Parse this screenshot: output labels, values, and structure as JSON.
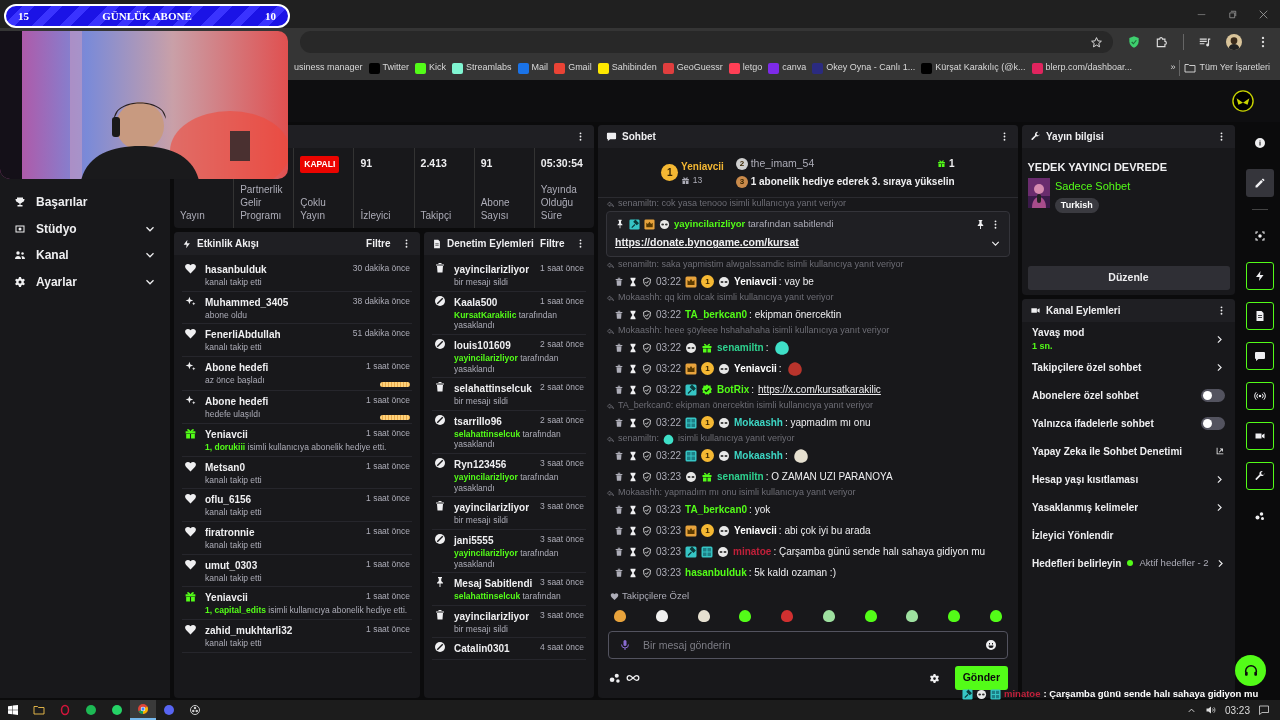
{
  "subscription_goal": {
    "current": "15",
    "title": "GÜNLÜK ABONE",
    "target": "10"
  },
  "browser": {
    "bookmarks": [
      {
        "label": "usiness manager"
      },
      {
        "label": "Twitter",
        "color": "#000000"
      },
      {
        "label": "Kick",
        "color": "#53fc18"
      },
      {
        "label": "Streamlabs",
        "color": "#80f5d2"
      },
      {
        "label": "Mail",
        "color": "#1a73e8"
      },
      {
        "label": "Gmail",
        "color": "#ea4335"
      },
      {
        "label": "Sahibinden",
        "color": "#ffe800"
      },
      {
        "label": "GeoGuessr",
        "color": "#e03e3e"
      },
      {
        "label": "letgo",
        "color": "#ff3f55"
      },
      {
        "label": "canva",
        "color": "#7d2ae8"
      },
      {
        "label": "Okey Oyna - Canlı 1...",
        "color": "#2b2b80"
      },
      {
        "label": "Kürşat Karakılıç (@k...",
        "color": "#000000"
      },
      {
        "label": "blerp.com/dashboar...",
        "color": "#e0245e"
      }
    ],
    "overflow": "»",
    "all_bookmarks": "Tüm Yer İşaretleri"
  },
  "sidebar": [
    {
      "kind": "trophy",
      "label": "Başarılar",
      "expandable": false
    },
    {
      "kind": "studio",
      "label": "Stüdyo",
      "expandable": true
    },
    {
      "kind": "people",
      "label": "Kanal",
      "expandable": true
    },
    {
      "kind": "gear",
      "label": "Ayarlar",
      "expandable": true
    }
  ],
  "stats": [
    {
      "label": "Yayın"
    },
    {
      "label": "Partnerlik Gelir Programı"
    },
    {
      "badge": "KAPALI",
      "label": "Çoklu Yayın"
    },
    {
      "value": "91",
      "label": "İzleyici"
    },
    {
      "value": "2.413",
      "label": "Takipçi"
    },
    {
      "value": "91",
      "label": "Abone Sayısı"
    },
    {
      "value": "05:30:54",
      "label": "Yayında Olduğu Süre"
    }
  ],
  "activity": {
    "title": "Etkinlik Akışı",
    "filter": "Filtre",
    "items": [
      {
        "kind": "heart",
        "name": "hasanbulduk",
        "time": "30 dakika önce",
        "text": "kanalı takip etti"
      },
      {
        "kind": "sparkle",
        "name": "Muhammed_3405",
        "time": "38 dakika önce",
        "text": "abone oldu"
      },
      {
        "kind": "heart",
        "name": "FenerliAbdullah",
        "time": "51 dakika önce",
        "text": "kanalı takip etti"
      },
      {
        "kind": "sparkle",
        "name": "Abone hedefi",
        "time": "1 saat önce",
        "text": "az önce başladı",
        "level": 1
      },
      {
        "kind": "sparkle",
        "name": "Abone hedefi",
        "time": "1 saat önce",
        "text": "hedefe ulaşıldı",
        "level": 1
      },
      {
        "kind": "gift",
        "name": "Yeniavcii",
        "time": "1 saat önce",
        "highlight": "1, dorukiii",
        "text": " isimli kullanıcıya abonelik hediye etti."
      },
      {
        "kind": "heart",
        "name": "Metsan0",
        "time": "1 saat önce",
        "text": "kanalı takip etti"
      },
      {
        "kind": "heart",
        "name": "oflu_6156",
        "time": "1 saat önce",
        "text": "kanalı takip etti"
      },
      {
        "kind": "heart",
        "name": "firatronnie",
        "time": "1 saat önce",
        "text": "kanalı takip etti"
      },
      {
        "kind": "heart",
        "name": "umut_0303",
        "time": "1 saat önce",
        "text": "kanalı takip etti"
      },
      {
        "kind": "gift",
        "name": "Yeniavcii",
        "time": "1 saat önce",
        "highlight": "1, capital_edits",
        "text": " isimli kullanıcıya abonelik hediye etti."
      },
      {
        "kind": "heart",
        "name": "zahid_mukhtarli32",
        "time": "1 saat önce",
        "text": "kanalı takip etti"
      }
    ]
  },
  "moderation": {
    "title": "Denetim Eylemleri",
    "filter": "Filtre",
    "items": [
      {
        "kind": "trash",
        "name": "yayincilarizliyor",
        "time": "1 saat önce",
        "text": "bir mesajı sildi"
      },
      {
        "kind": "ban",
        "name": "Kaala500",
        "time": "1 saat önce",
        "actor": "KursatKarakilic",
        "text": " tarafından yasaklandı"
      },
      {
        "kind": "ban",
        "name": "louis101609",
        "time": "2 saat önce",
        "actor": "yayincilarizliyor",
        "text": " tarafından yasaklandı"
      },
      {
        "kind": "trash",
        "name": "selahattinselcuk",
        "time": "2 saat önce",
        "text": "bir mesajı sildi"
      },
      {
        "kind": "ban",
        "name": "tsarrillo96",
        "time": "2 saat önce",
        "actor": "selahattinselcuk",
        "text": " tarafından yasaklandı"
      },
      {
        "kind": "ban",
        "name": "Ryn123456",
        "time": "3 saat önce",
        "actor": "yayincilarizliyor",
        "text": " tarafından yasaklandı"
      },
      {
        "kind": "trash",
        "name": "yayincilarizliyor",
        "time": "3 saat önce",
        "text": "bir mesajı sildi"
      },
      {
        "kind": "ban",
        "name": "jani5555",
        "time": "3 saat önce",
        "actor": "yayincilarizliyor",
        "text": " tarafından yasaklandı"
      },
      {
        "kind": "pin",
        "name": "Mesaj Sabitlendi",
        "time": "3 saat önce",
        "actor": "selahattinselcuk",
        "text": " tarafından"
      },
      {
        "kind": "trash",
        "name": "yayincilarizliyor",
        "time": "3 saat önce",
        "text": "bir mesajı sildi"
      },
      {
        "kind": "ban",
        "name": "Catalin0301",
        "time": "4 saat önce"
      }
    ]
  },
  "chat": {
    "title": "Sohbet",
    "leaderboard": {
      "first": {
        "rank": "1",
        "name": "Yeniavcii",
        "count": "13"
      },
      "second": {
        "rank": "2",
        "name": "the_imam_54",
        "count": "1"
      },
      "third": {
        "rank": "3",
        "text": "1 abonelik hediye ederek 3. sıraya yükselin"
      }
    },
    "top_reply": "senamiltn: cok yasa tenooo isimli kullanıcıya yanıt veriyor",
    "pinned": {
      "by": "yayincilarizliyor",
      "text": "tarafından sabitlendi",
      "link": "https://donate.bynogame.com/kursat"
    },
    "messages": [
      {
        "reply": "senamiltn: saka yapmistim alwgalssamdic isimli kullanıcıya yanıt veriyor",
        "time": "03:22",
        "badges": [
          {
            "kind": "crown"
          },
          {
            "kind": "rank",
            "label": "1"
          },
          {
            "kind": "panda"
          }
        ],
        "user": "Yeniavcii",
        "color": "#ffffff",
        "kind": "text",
        "text": ": vay be"
      },
      {
        "reply": "Mokaashh: qq kim olcak isimli kullanıcıya yanıt veriyor",
        "time": "03:22",
        "user": "TA_berkcan0",
        "color": "#53fc18",
        "kind": "text",
        "text": ": ekipman önercektin"
      },
      {
        "reply": "Mokaashh: heee şöyleee hshahahaha isimli kullanıcıya yanıt veriyor",
        "time": "03:22",
        "badges": [
          {
            "kind": "panda"
          },
          {
            "kind": "gift"
          }
        ],
        "user": "senamiltn",
        "color": "#2ed18f",
        "kind": "emote",
        "text": ":",
        "emote": {
          "kind": "cat"
        }
      },
      {
        "time": "03:22",
        "badges": [
          {
            "kind": "crown"
          },
          {
            "kind": "rank",
            "label": "1"
          },
          {
            "kind": "panda"
          }
        ],
        "user": "Yeniavcii",
        "color": "#ffffff",
        "kind": "emote",
        "text": ":",
        "emote": {
          "kind": "mask"
        }
      },
      {
        "time": "03:22",
        "badges": [
          {
            "kind": "hammer"
          },
          {
            "kind": "verified"
          }
        ],
        "user": "BotRix",
        "color": "#53fc18",
        "kind": "link",
        "text": ":",
        "link": "https://x.com/kursatkarakilic"
      },
      {
        "reply": "TA_berkcan0: ekipman önercektin isimli kullanıcıya yanıt veriyor",
        "time": "03:22",
        "badges": [
          {
            "kind": "grid"
          },
          {
            "kind": "rank",
            "label": "1"
          },
          {
            "kind": "panda"
          }
        ],
        "user": "Mokaashh",
        "color": "#3dd6c4",
        "kind": "text",
        "text": ": yapmadım mı onu"
      },
      {
        "reply": "senamiltn:",
        "reply_emote": {
          "kind": "cat"
        },
        "reply_tail": "isimli kullanıcıya yanıt veriyor",
        "time": "03:22",
        "badges": [
          {
            "kind": "grid"
          },
          {
            "kind": "rank",
            "label": "1"
          },
          {
            "kind": "panda"
          }
        ],
        "user": "Mokaashh",
        "color": "#3dd6c4",
        "kind": "emote",
        "text": ":",
        "emote": {
          "kind": "ghost"
        }
      },
      {
        "time": "03:23",
        "badges": [
          {
            "kind": "panda"
          },
          {
            "kind": "gift"
          }
        ],
        "user": "senamiltn",
        "color": "#2ed18f",
        "kind": "text",
        "text": ": O ZAMAN UZI PARANOYA"
      },
      {
        "reply": "Mokaashh: yapmadım mı onu isimli kullanıcıya yanıt veriyor",
        "time": "03:23",
        "user": "TA_berkcan0",
        "color": "#53fc18",
        "kind": "text",
        "text": ": yok"
      },
      {
        "time": "03:23",
        "badges": [
          {
            "kind": "crown"
          },
          {
            "kind": "rank",
            "label": "1"
          },
          {
            "kind": "panda"
          }
        ],
        "user": "Yeniavcii",
        "color": "#ffffff",
        "kind": "text",
        "text": ": abi çok iyi bu arada"
      },
      {
        "time": "03:23",
        "badges": [
          {
            "kind": "hammer"
          },
          {
            "kind": "grid"
          },
          {
            "kind": "panda"
          }
        ],
        "user": "minatoe",
        "color": "#c0203a",
        "kind": "text",
        "text": ": Çarşamba günü sende halı sahaya gidiyon mu"
      },
      {
        "time": "03:23",
        "user": "hasanbulduk",
        "color": "#53fc18",
        "kind": "text",
        "text": ": 5k kaldı ozaman :)"
      }
    ],
    "emote_label": "Takipçilere Özel",
    "emotes": [
      {
        "kind": "coin"
      },
      {
        "kind": "panda"
      },
      {
        "kind": "ghost"
      },
      {
        "kind": "cup"
      },
      {
        "kind": "angry"
      },
      {
        "kind": "skull"
      },
      {
        "kind": "blob"
      },
      {
        "kind": "skull"
      },
      {
        "kind": "blob"
      },
      {
        "kind": "blob"
      }
    ],
    "placeholder": "Bir mesaj gönderin",
    "send": "Gönder"
  },
  "stream_info": {
    "title": "Yayın bilgisi",
    "status": "YEDEK YAYINCI DEVREDE",
    "category": "Sadece Sohbet",
    "tag": "Turkish",
    "button": "Düzenle"
  },
  "channel_actions": {
    "title": "Kanal Eylemleri",
    "items": [
      {
        "kind": "arrow",
        "label": "Yavaş mod",
        "sub": "1 sn."
      },
      {
        "kind": "arrow",
        "label": "Takipçilere özel sohbet"
      },
      {
        "kind": "toggle",
        "label": "Abonelere özel sohbet",
        "on": false
      },
      {
        "kind": "toggle",
        "label": "Yalnızca ifadelerle sohbet",
        "on": false
      },
      {
        "kind": "external",
        "label": "Yapay Zeka ile Sohbet Denetimi"
      },
      {
        "kind": "arrow",
        "label": "Hesap yaşı kısıtlaması"
      },
      {
        "kind": "arrow",
        "label": "Yasaklanmış kelimeler"
      },
      {
        "kind": "plain",
        "label": "İzleyici Yönlendir"
      },
      {
        "kind": "status",
        "label": "Hedefleri belirleyin",
        "status": "Aktif hedefler - 2",
        "color": "#53fc18"
      }
    ]
  },
  "rail": [
    {
      "kind": "info",
      "selected": false,
      "outlined": false
    },
    {
      "kind": "pencil",
      "selected": true,
      "outlined": false
    },
    {
      "kind": "camera",
      "selected": false,
      "outlined": false
    },
    {
      "kind": "bolt",
      "selected": false,
      "outlined": true
    },
    {
      "kind": "doc",
      "selected": false,
      "outlined": true
    },
    {
      "kind": "chat",
      "selected": false,
      "outlined": true
    },
    {
      "kind": "broadcast",
      "selected": false,
      "outlined": true
    },
    {
      "kind": "video",
      "selected": false,
      "outlined": true
    },
    {
      "kind": "wrench",
      "selected": false,
      "outlined": true
    },
    {
      "kind": "dots",
      "selected": false,
      "outlined": false
    }
  ],
  "overlay_message": {
    "user": "minatoe",
    "color": "#c0203a",
    "text": " : Çarşamba günü sende halı sahaya gidiyon mu"
  },
  "taskbar": {
    "apps": [
      {
        "kind": "windows",
        "selected": false
      },
      {
        "kind": "folder",
        "selected": false
      },
      {
        "kind": "ring",
        "selected": false
      },
      {
        "kind": "spotify",
        "selected": false
      },
      {
        "kind": "whatsapp",
        "selected": false
      },
      {
        "kind": "chrome",
        "selected": true
      },
      {
        "kind": "discord",
        "selected": false
      },
      {
        "kind": "obs",
        "selected": false
      }
    ],
    "clock": "03:23"
  }
}
